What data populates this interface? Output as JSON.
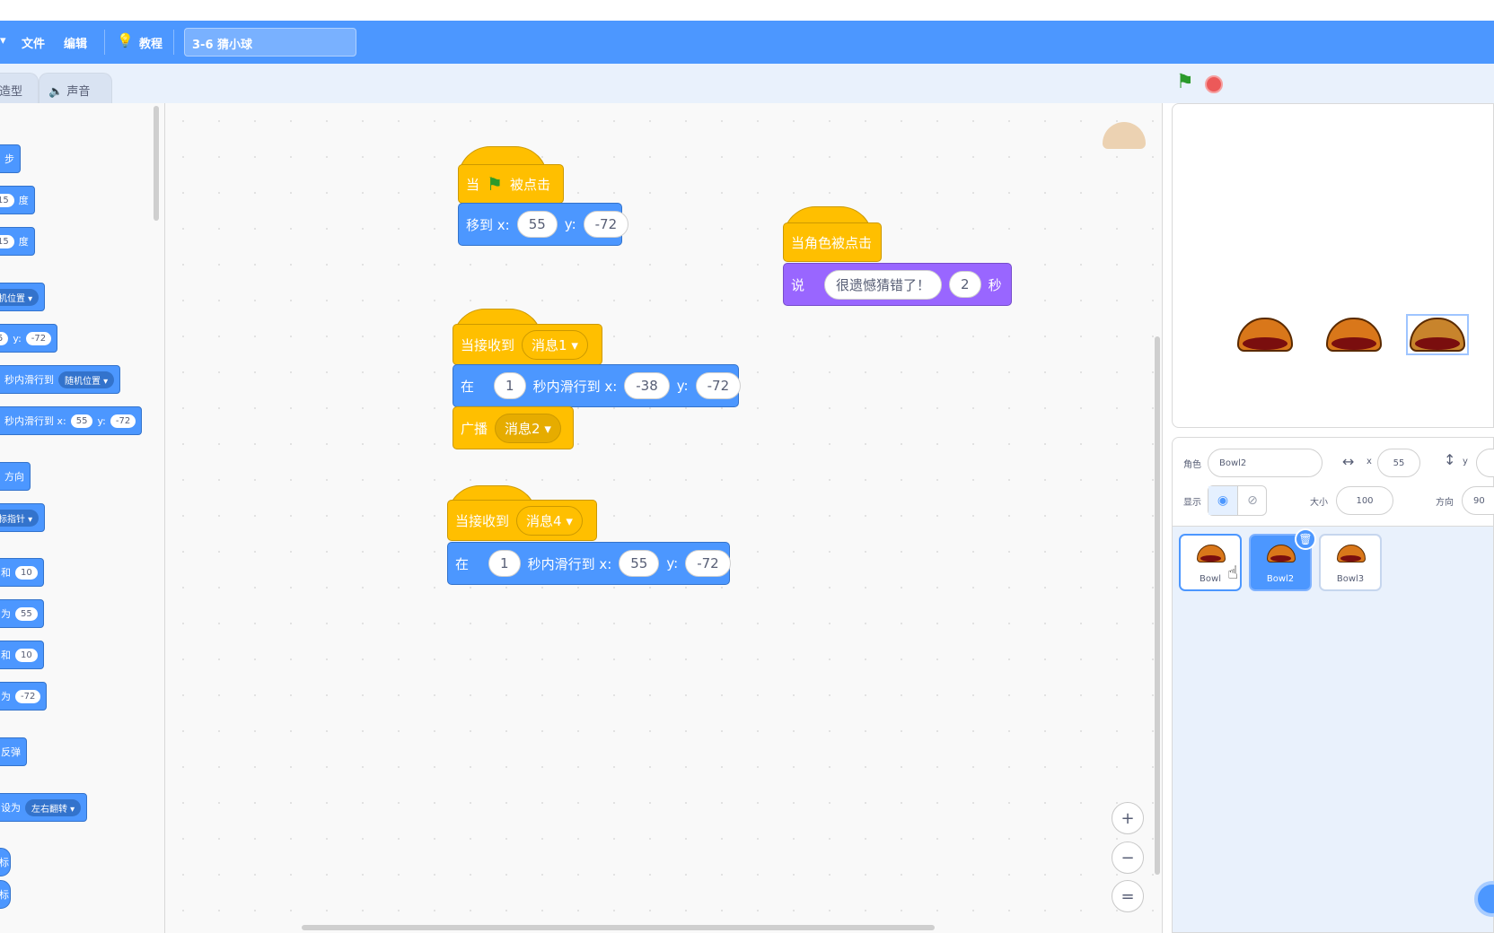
{
  "menu": {
    "file": "文件",
    "edit": "编辑",
    "tutorials": "教程",
    "project_title": "3-6 猜小球"
  },
  "tabs": {
    "costumes": "造型",
    "sounds": "声音"
  },
  "palette": {
    "steps": "步",
    "turn_right_val": "15",
    "turn_right_unit": "度",
    "turn_left_val": "15",
    "turn_left_unit": "度",
    "goto_dd": "机位置",
    "goto_xy_x": "5",
    "goto_xy_ylabel": "y:",
    "goto_xy_y": "-72",
    "glide_rand_text": "秒内滑行到",
    "glide_rand_dd": "随机位置",
    "glide_xy_text": "秒内滑行到 x:",
    "glide_xy_x": "55",
    "glide_xy_ylabel": "y:",
    "glide_xy_y": "-72",
    "direction": "方向",
    "pointer_dd": "标指针",
    "change_x_prefix": "和",
    "change_x_val": "10",
    "set_x_prefix": "为",
    "set_x_val": "55",
    "change_y_prefix": "和",
    "change_y_val": "10",
    "set_y_prefix": "为",
    "set_y_val": "-72",
    "bounce": "反弹",
    "rotation_text": "设为",
    "rotation_dd": "左右翻转",
    "r1": "标",
    "r2": "标"
  },
  "scripts": {
    "s1": {
      "when": "当",
      "clicked": "被点击",
      "goto_label": "移到 x:",
      "x": "55",
      "ylabel": "y:",
      "y": "-72"
    },
    "s2": {
      "hat": "当角色被点击",
      "say": "说",
      "message": "很遗憾猜错了！",
      "secs": "2",
      "unit": "秒"
    },
    "s3": {
      "when_recv": "当接收到",
      "msg": "消息1",
      "in": "在",
      "secs": "1",
      "glide": "秒内滑行到 x:",
      "x": "-38",
      "ylabel": "y:",
      "y": "-72",
      "broadcast": "广播",
      "bmsg": "消息2"
    },
    "s4": {
      "when_recv": "当接收到",
      "msg": "消息4",
      "in": "在",
      "secs": "1",
      "glide": "秒内滑行到 x:",
      "x": "55",
      "ylabel": "y:",
      "y": "-72"
    }
  },
  "zoom": {
    "in": "+",
    "out": "−",
    "reset": "="
  },
  "sprite_info": {
    "sprite_label": "角色",
    "sprite_name": "Bowl2",
    "x_label": "x",
    "x": "55",
    "y_label": "y",
    "show_label": "显示",
    "size_label": "大小",
    "size": "100",
    "direction_label": "方向",
    "direction": "90"
  },
  "sprites": [
    {
      "name": "Bowl"
    },
    {
      "name": "Bowl2"
    },
    {
      "name": "Bowl3"
    }
  ],
  "colors": {
    "menu": "#4c97ff",
    "motion": "#4c97ff",
    "events": "#ffbf00",
    "looks": "#9966ff"
  }
}
